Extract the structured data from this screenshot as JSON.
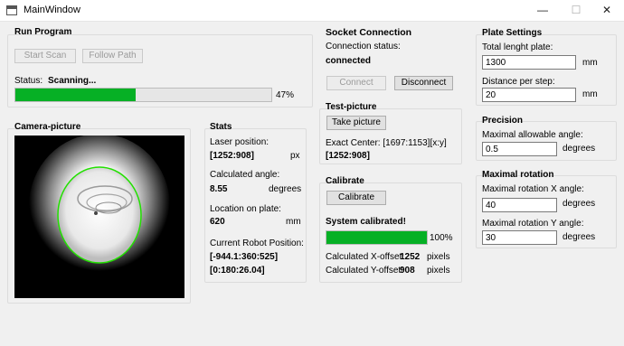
{
  "window": {
    "title": "MainWindow",
    "icon": "app-window-icon",
    "minimize": "—",
    "maximize": "☐",
    "close": "✕"
  },
  "run_program": {
    "title": "Run Program",
    "start_scan_label": "Start Scan",
    "follow_path_label": "Follow Path",
    "status_label": "Status:",
    "status_value": "Scanning...",
    "progress_percent": 47,
    "progress_text": "47%"
  },
  "camera": {
    "title": "Camera-picture"
  },
  "stats": {
    "title": "Stats",
    "laser_label": "Laser position:",
    "laser_value": "[1252:908]",
    "laser_unit": "px",
    "angle_label": "Calculated angle:",
    "angle_value": "8.55",
    "angle_unit": "degrees",
    "location_label": "Location on plate:",
    "location_value": "620",
    "location_unit": "mm",
    "robot_label": "Current Robot Position:",
    "robot_value_1": "[-944.1:360:525]",
    "robot_value_2": "[0:180:26.04]"
  },
  "socket": {
    "title": "Socket Connection",
    "status_label": "Connection status:",
    "status_value": "connected",
    "connect_label": "Connect",
    "disconnect_label": "Disconnect"
  },
  "test_picture": {
    "title": "Test-picture",
    "take_picture_label": "Take picture",
    "center_text": "Exact Center: [1697:1153][x:y]",
    "center_value": "[1252:908]"
  },
  "calibrate": {
    "title": "Calibrate",
    "button_label": "Calibrate",
    "status": "System calibrated!",
    "progress_percent": 100,
    "progress_text": "100%",
    "x_offset_label": "Calculated X-offset:",
    "x_offset_value": "1252",
    "y_offset_label": "Calculated Y-offset:",
    "y_offset_value": "908",
    "unit": "pixels"
  },
  "plate_settings": {
    "title": "Plate Settings",
    "length_label": "Total lenght plate:",
    "length_value": "1300",
    "length_unit": "mm",
    "distance_label": "Distance per step:",
    "distance_value": "20",
    "distance_unit": "mm"
  },
  "precision": {
    "title": "Precision",
    "label": "Maximal allowable angle:",
    "value": "0.5",
    "unit": "degrees"
  },
  "max_rotation": {
    "title": "Maximal rotation",
    "x_label": "Maximal rotation X angle:",
    "x_value": "40",
    "y_label": "Maximal rotation  Y angle:",
    "y_value": "30",
    "unit": "degrees"
  },
  "colors": {
    "progress_green": "#06b025",
    "contour_green": "#22e000"
  }
}
